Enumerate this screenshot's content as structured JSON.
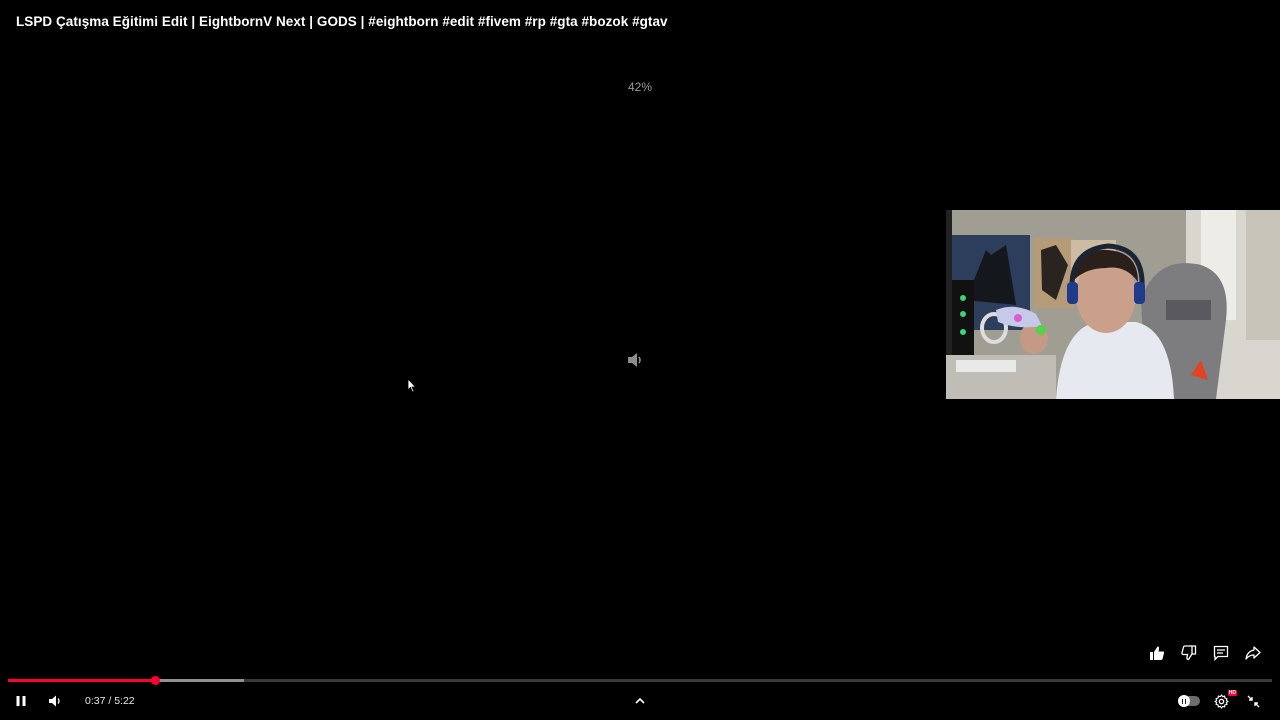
{
  "video": {
    "title": "LSPD Çatışma Eğitimi Edit | EightbornV Next | GODS | #eightborn #edit #fivem #rp #gta #bozok #gtav",
    "volume_indicator": "42%",
    "playback_state": "playing",
    "muted": false
  },
  "progress": {
    "played_fraction": 0.1164,
    "buffered_fraction": 0.1866
  },
  "controls": {
    "current_time": "0:37",
    "separator": " / ",
    "duration": "5:22",
    "autoplay_on": false,
    "quality_badge": "HD"
  },
  "actions": [
    {
      "name": "like-icon"
    },
    {
      "name": "dislike-icon"
    },
    {
      "name": "comments-icon"
    },
    {
      "name": "share-icon"
    }
  ],
  "colors": {
    "accent": "#ff0033",
    "background": "#000000",
    "text": "#ffffff",
    "muted_text": "#9a9a9a"
  }
}
